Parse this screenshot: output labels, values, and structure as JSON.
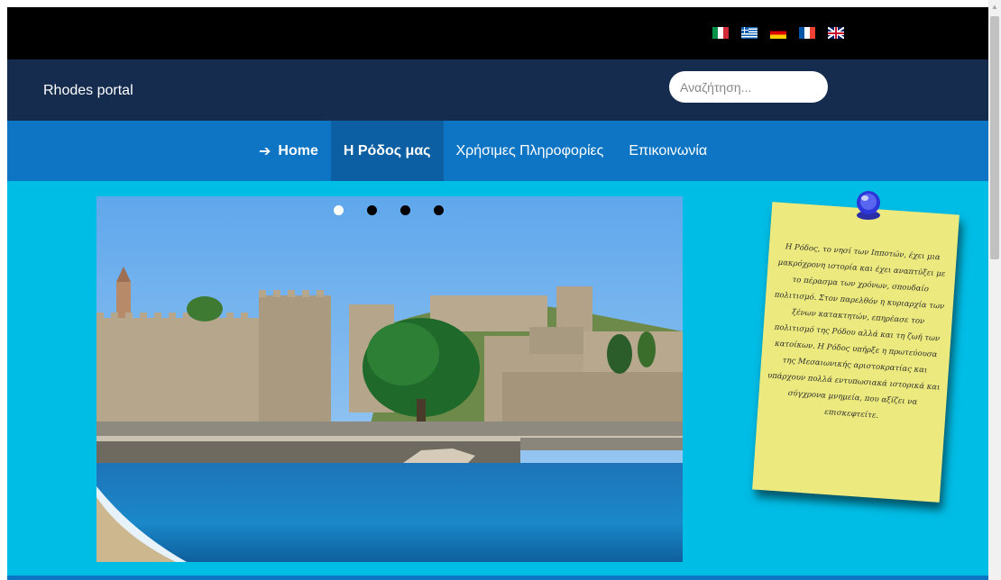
{
  "languages": [
    {
      "code": "it",
      "icon": "flag-italy-icon"
    },
    {
      "code": "gr",
      "icon": "flag-greece-icon"
    },
    {
      "code": "de",
      "icon": "flag-germany-icon"
    },
    {
      "code": "fr",
      "icon": "flag-france-icon"
    },
    {
      "code": "uk",
      "icon": "flag-uk-icon"
    }
  ],
  "header": {
    "brand": "Rhodes portal",
    "search_placeholder": "Αναζήτηση..."
  },
  "nav": {
    "items": [
      {
        "label": "Home",
        "icon": "arrow-right-icon",
        "active": false
      },
      {
        "label": "Η Ρόδος μας",
        "active": true
      },
      {
        "label": "Χρήσιμες Πληροφορίες",
        "active": false
      },
      {
        "label": "Επικοινωνία",
        "active": false
      }
    ]
  },
  "slider": {
    "slide_count": 4,
    "active_index": 0
  },
  "note": {
    "text": "Η Ρόδος, το νησί των Ιπποτών, έχει μια μακρόχρονη ιστορία και έχει αναπτύξει με το πέρασμα των χρόνων, σπουδαίο πολιτισμό. Στον παρελθόν η κυριαρχία των ξένων κατακτητών, επηρέασε τον πολιτισμό της Ρόδου αλλά και τη ζωή των κατοίκων. Η Ρόδος υπήρξε η πρωτεύουσα της Μεσαιωνικής αριστοκρατίας και υπάρχουν πολλά εντυπωσιακά ιστορικά και σύγχρονα μνημεία, που αξίζει να επισκεφτείτε."
  },
  "colors": {
    "topbar": "#000000",
    "header": "#152c4f",
    "nav": "#0e75c4",
    "nav_active": "#0b5fa2",
    "main": "#00bde6",
    "note": "#ecea7f"
  }
}
